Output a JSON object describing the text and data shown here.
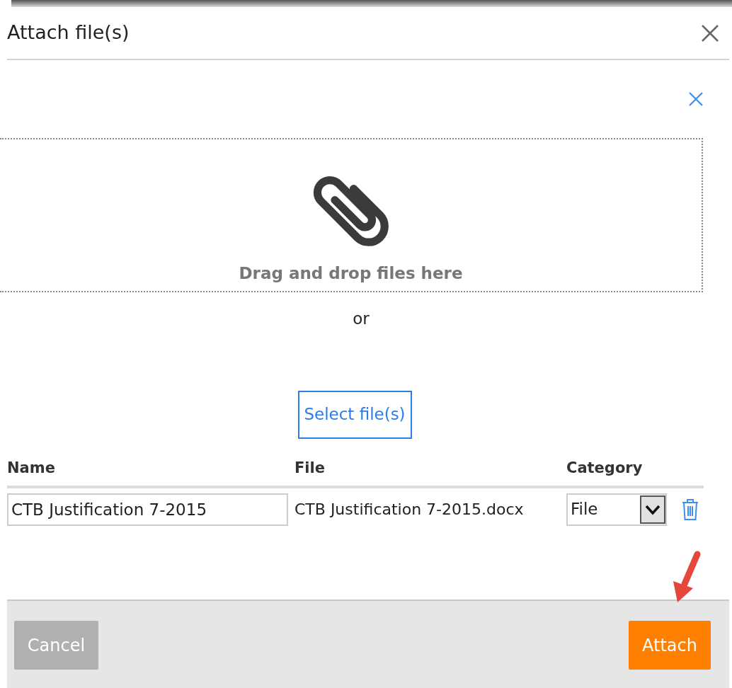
{
  "dialog": {
    "title": "Attach file(s)"
  },
  "dropzone": {
    "label": "Drag and drop files here",
    "separator": "or",
    "button": "Select file(s)"
  },
  "table": {
    "columns": [
      "Name",
      "File",
      "Category"
    ],
    "rows": [
      {
        "name": "CTB Justification 7-2015",
        "file": "CTB Justification 7-2015.docx",
        "category": "File"
      }
    ]
  },
  "buttons": [
    {
      "label": "Cancel",
      "kind": "secondary"
    },
    {
      "label": "Attach",
      "kind": "primary"
    }
  ]
}
